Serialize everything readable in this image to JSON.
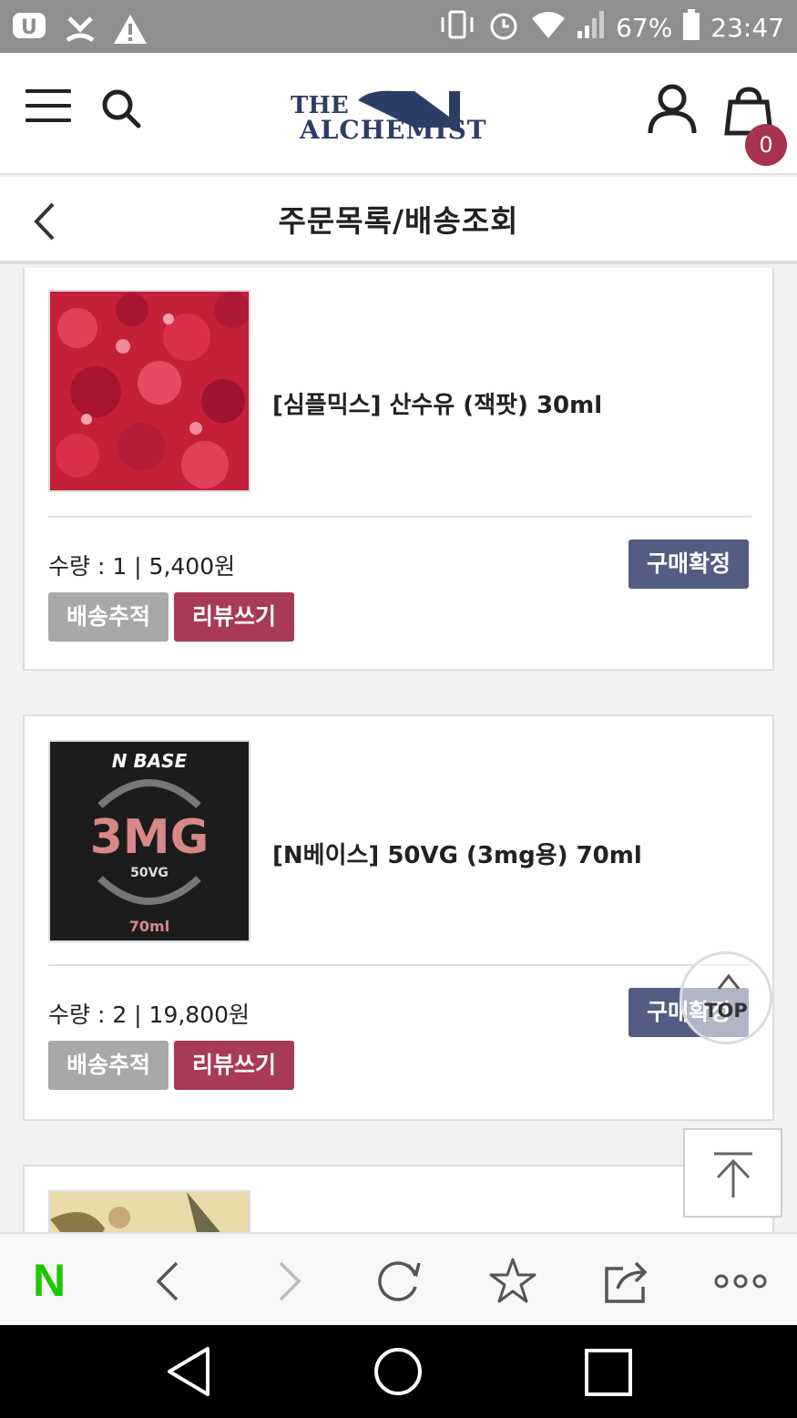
{
  "status_bar": {
    "battery_percent": "67%",
    "time": "23:47"
  },
  "header": {
    "logo_line1": "THE",
    "logo_line2": "ALCHEMIST",
    "cart_count": "0"
  },
  "page": {
    "title": "주문목록/배송조회"
  },
  "orders": [
    {
      "product_name": "[심플믹스] 산수유 (잭팟) 30ml",
      "quantity_price": "수량 : 1 | 5,400원",
      "confirm_label": "구매확정",
      "track_label": "배송추적",
      "review_label": "리뷰쓰기"
    },
    {
      "product_name": "[N베이스] 50VG (3mg용) 70ml",
      "quantity_price": "수량 : 2 | 19,800원",
      "confirm_label": "구매확정",
      "track_label": "배송추적",
      "review_label": "리뷰쓰기",
      "thumb_brand": "N BASE",
      "thumb_strength": "3MG",
      "thumb_vg": "50VG",
      "thumb_volume": "70ml"
    }
  ],
  "floating": {
    "top_label": "TOP"
  },
  "browser_bar": {
    "naver_logo": "N"
  },
  "colors": {
    "accent_red": "#a83a54",
    "confirm_navy": "#535d84",
    "naver_green": "#1ec800"
  }
}
